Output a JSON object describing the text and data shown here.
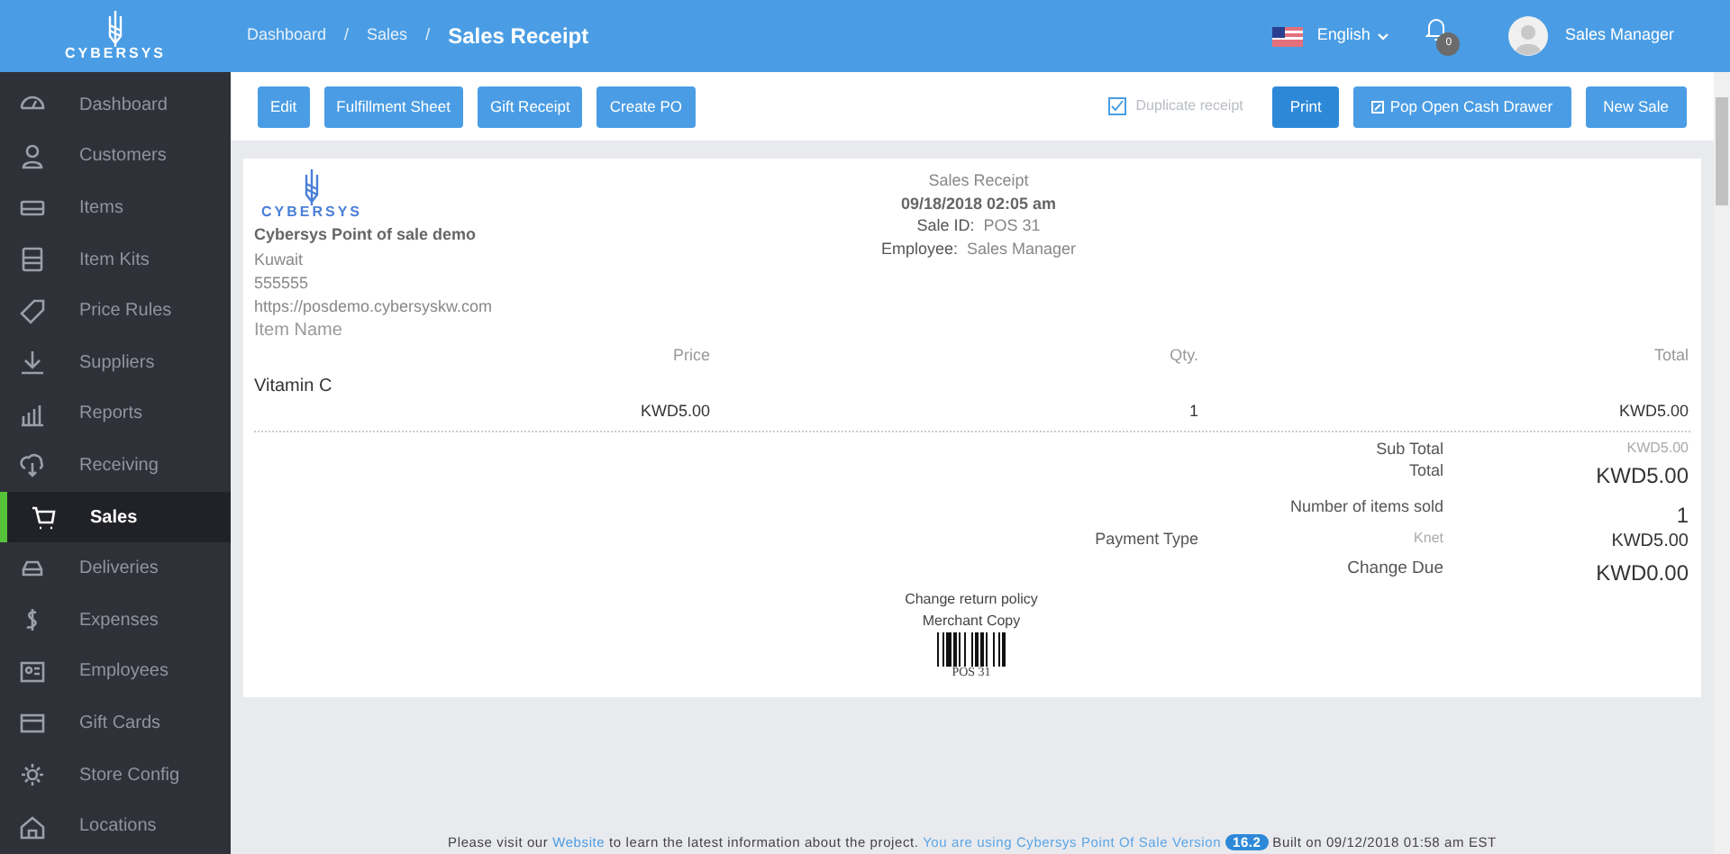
{
  "logo": {
    "text": "CYBERSYS"
  },
  "breadcrumb": [
    {
      "label": "Dashboard",
      "separator": "/"
    },
    {
      "label": "Sales",
      "separator": "/"
    }
  ],
  "page_title": "Sales Receipt",
  "header": {
    "language": "English",
    "notifications": "0",
    "user": "Sales Manager"
  },
  "sidebar": {
    "items": [
      {
        "label": "Dashboard",
        "selected": false
      },
      {
        "label": "Customers",
        "selected": false
      },
      {
        "label": "Items",
        "selected": false
      },
      {
        "label": "Item Kits",
        "selected": false
      },
      {
        "label": "Price Rules",
        "selected": false
      },
      {
        "label": "Suppliers",
        "selected": false
      },
      {
        "label": "Reports",
        "selected": false
      },
      {
        "label": "Receiving",
        "selected": false
      },
      {
        "label": "Sales",
        "selected": true
      },
      {
        "label": "Deliveries",
        "selected": false
      },
      {
        "label": "Expenses",
        "selected": false
      },
      {
        "label": "Employees",
        "selected": false
      },
      {
        "label": "Gift Cards",
        "selected": false
      },
      {
        "label": "Store Config",
        "selected": false
      },
      {
        "label": "Locations",
        "selected": false
      }
    ]
  },
  "toolbar": {
    "left_buttons": [
      "Edit",
      "Fulfillment Sheet",
      "Gift Receipt",
      "Create PO"
    ],
    "duplicate_receipt": {
      "label": "Duplicate receipt",
      "checked": true
    },
    "right_buttons": [
      {
        "label": "Print",
        "primary": true
      },
      {
        "label": "Pop Open Cash Drawer",
        "primary": false
      },
      {
        "label": "New Sale",
        "primary": false
      }
    ]
  },
  "receipt": {
    "logo_text": "CYBERSYS",
    "company": "Cybersys Point of sale demo",
    "address": [
      "Kuwait",
      "555555",
      "https://posdemo.cybersyskw.com"
    ],
    "title": "Sales Receipt",
    "date": "09/18/2018 02:05 am",
    "meta": [
      {
        "label": "Sale ID:",
        "value": "POS 31"
      },
      {
        "label": "Employee:",
        "value": "Sales Manager"
      }
    ],
    "item_name_header": "Item Name",
    "columns": [
      "Price",
      "Qty.",
      "Total"
    ],
    "items": [
      {
        "name": "Vitamin C",
        "price": "KWD5.00",
        "qty": "1",
        "total": "KWD5.00"
      }
    ],
    "sub_total": {
      "label": "Sub Total",
      "value": "KWD5.00"
    },
    "total": {
      "label": "Total",
      "value": "KWD5.00"
    },
    "items_sold": {
      "label": "Number of items sold",
      "value": "1"
    },
    "payment": {
      "label": "Payment Type",
      "type": "Knet",
      "value": "KWD5.00"
    },
    "change_due": {
      "label": "Change Due",
      "value": "KWD0.00"
    },
    "return_policy": "Change return policy",
    "copy": "Merchant Copy",
    "barcode_text": "POS 31"
  },
  "footer": {
    "before": "Please visit our",
    "link": "Website",
    "middle": "to learn the latest information about the project.",
    "version_text": "You are using Cybersys Point Of Sale Version",
    "version": "16.2",
    "built": "Built on 09/12/2018 01:58 am EST"
  }
}
